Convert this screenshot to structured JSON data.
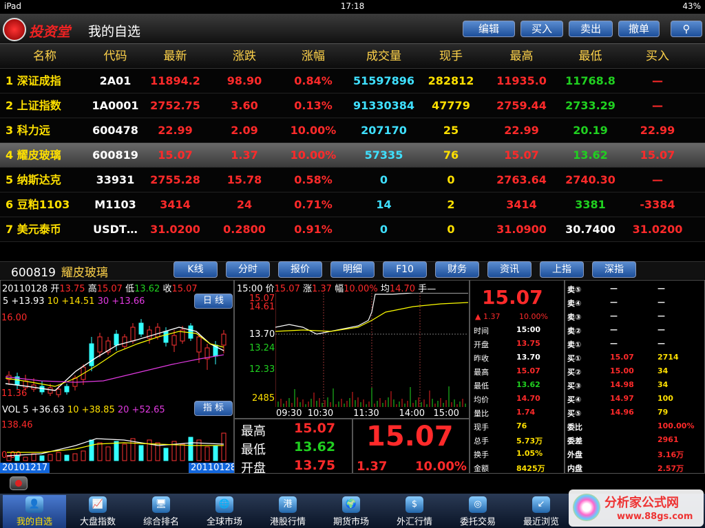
{
  "status": {
    "carrier": "iPad",
    "time": "17:18",
    "battery": "43%"
  },
  "title": {
    "logo": "投资堂",
    "page": "我的自选"
  },
  "toolbar": {
    "edit": "编辑",
    "buy": "买入",
    "sell": "卖出",
    "cancel": "撤单"
  },
  "headers": [
    "名称",
    "代码",
    "最新",
    "涨跌",
    "涨幅",
    "成交量",
    "现手",
    "最高",
    "最低",
    "买入"
  ],
  "rows": [
    [
      "1 深证成指",
      "2A01",
      "11894.2",
      "98.90",
      "0.84%",
      "51597896",
      "282812",
      "11935.0",
      "11768.8",
      "—"
    ],
    [
      "2 上证指数",
      "1A0001",
      "2752.75",
      "3.60",
      "0.13%",
      "91330384",
      "47779",
      "2759.44",
      "2733.29",
      "—"
    ],
    [
      "3 科力远",
      "600478",
      "22.99",
      "2.09",
      "10.00%",
      "207170",
      "25",
      "22.99",
      "20.19",
      "22.99"
    ],
    [
      "4 耀皮玻璃",
      "600819",
      "15.07",
      "1.37",
      "10.00%",
      "57335",
      "76",
      "15.07",
      "13.62",
      "15.07"
    ],
    [
      "5 纳斯达克",
      "33931",
      "2755.28",
      "15.78",
      "0.58%",
      "0",
      "0",
      "2763.64",
      "2740.30",
      "—"
    ],
    [
      "6 豆粕1103",
      "M1103",
      "3414",
      "24",
      "0.71%",
      "14",
      "2",
      "3414",
      "3381",
      "-3384"
    ],
    [
      "7 美元泰币",
      "USDT…",
      "31.0200",
      "0.2800",
      "0.91%",
      "0",
      "0",
      "31.0900",
      "30.7400",
      "31.0200"
    ]
  ],
  "detail": {
    "code": "600819",
    "name": "耀皮玻璃",
    "tabs": [
      "K线",
      "分时",
      "报价",
      "明细",
      "F10",
      "财务",
      "资讯",
      "上指",
      "深指"
    ],
    "kline": {
      "date": "20110128",
      "open_l": "开",
      "open": "13.75",
      "high_l": "高",
      "high": "15.07",
      "low_l": "低",
      "low": "13.62",
      "close_l": "收",
      "close": "15.07",
      "ma": "5 +13.93",
      "ma10": "10 +14.51",
      "ma30": "30 +13.66",
      "day_btn": "日 线",
      "top": "16.00",
      "bottom": "11.36",
      "vol": "VOL",
      "vol5": "5 +36.63",
      "vol10": "10 +38.85",
      "vol20": "20 +52.65",
      "ind_btn": "指 标",
      "vtop": "138.46",
      "vbot": "0.00",
      "d1": "20101217",
      "d2": "20110128"
    },
    "tick": {
      "time": "15:00",
      "price_l": "价",
      "price": "15.07",
      "chg_l": "涨",
      "chg": "1.37",
      "pct_l": "幅",
      "pct": "10.00%",
      "avg_l": "均",
      "avg": "14.70",
      "hand_l": "手",
      "hand": "—",
      "y1": "15.07",
      "y2": "14.61",
      "y3": "13.70",
      "y4": "13.24",
      "y5": "12.33",
      "y6": "2485",
      "x1": "09:30",
      "x2": "10:30",
      "x3": "11:30",
      "x4": "14:00",
      "x5": "15:00"
    },
    "summary": {
      "high_l": "最高",
      "high": "15.07",
      "low_l": "最低",
      "low": "13.62",
      "open_l": "开盘",
      "open": "13.75",
      "big": "15.07",
      "chg": "1.37",
      "pct": "10.00%"
    },
    "quote": {
      "price": "15.07",
      "up": "▲ 1.37",
      "pct": "10.00%",
      "items": [
        [
          "时间",
          "15:00",
          "wht"
        ],
        [
          "开盘",
          "13.75",
          "red"
        ],
        [
          "昨收",
          "13.70",
          "wht"
        ],
        [
          "最高",
          "15.07",
          "red"
        ],
        [
          "最低",
          "13.62",
          "green"
        ],
        [
          "均价",
          "14.70",
          "red"
        ],
        [
          "量比",
          "1.74",
          "red"
        ],
        [
          "现手",
          "76",
          "yel"
        ],
        [
          "总手",
          "5.73万",
          "yel"
        ],
        [
          "换手",
          "1.05%",
          "yel"
        ],
        [
          "金额",
          "8425万",
          "yel"
        ]
      ]
    },
    "book": [
      [
        "卖⑤",
        "—",
        "—"
      ],
      [
        "卖④",
        "—",
        "—"
      ],
      [
        "卖③",
        "—",
        "—"
      ],
      [
        "卖②",
        "—",
        "—"
      ],
      [
        "卖①",
        "—",
        "—"
      ],
      [
        "买①",
        "15.07",
        "2714"
      ],
      [
        "买②",
        "15.00",
        "34"
      ],
      [
        "买③",
        "14.98",
        "34"
      ],
      [
        "买④",
        "14.97",
        "100"
      ],
      [
        "买⑤",
        "14.96",
        "79"
      ],
      [
        "委比",
        "100.00%",
        ""
      ],
      [
        "委差",
        "2961",
        ""
      ],
      [
        "外盘",
        "3.16万",
        ""
      ],
      [
        "内盘",
        "2.57万",
        ""
      ]
    ]
  },
  "nav": [
    "我的自选",
    "大盘指数",
    "综合排名",
    "全球市场",
    "港股行情",
    "期货市场",
    "外汇行情",
    "委托交易",
    "最近浏览"
  ],
  "watermark": {
    "title": "分析家公式网",
    "url": "www.88gs.com"
  }
}
